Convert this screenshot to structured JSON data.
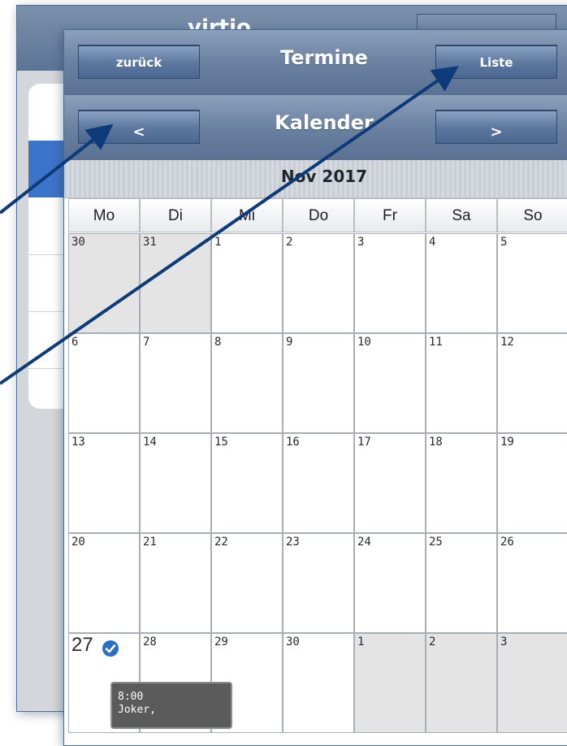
{
  "background_window": {
    "title": "virtio"
  },
  "header": {
    "back_label": "zurück",
    "title": "Termine",
    "list_label": "Liste"
  },
  "nav": {
    "prev_label": "<",
    "title": "Kalender",
    "next_label": ">"
  },
  "calendar": {
    "month": "Nov 2017",
    "weekdays": [
      "Mo",
      "Di",
      "Mi",
      "Do",
      "Fr",
      "Sa",
      "So"
    ],
    "weeks": [
      [
        "30",
        "31",
        "1",
        "2",
        "3",
        "4",
        "5"
      ],
      [
        "6",
        "7",
        "8",
        "9",
        "10",
        "11",
        "12"
      ],
      [
        "13",
        "14",
        "15",
        "16",
        "17",
        "18",
        "19"
      ],
      [
        "20",
        "21",
        "22",
        "23",
        "24",
        "25",
        "26"
      ],
      [
        "27",
        "28",
        "29",
        "30",
        "1",
        "2",
        "3"
      ]
    ],
    "today": "27",
    "event": {
      "time": "8:00",
      "title": "Joker,"
    }
  },
  "colors": {
    "header_blue": "#6a81a1",
    "button_blue": "#5f79a0",
    "arrow": "#0d3a78",
    "check": "#2b6fc1"
  },
  "icons": {
    "today_marker": "check-circle-icon"
  }
}
